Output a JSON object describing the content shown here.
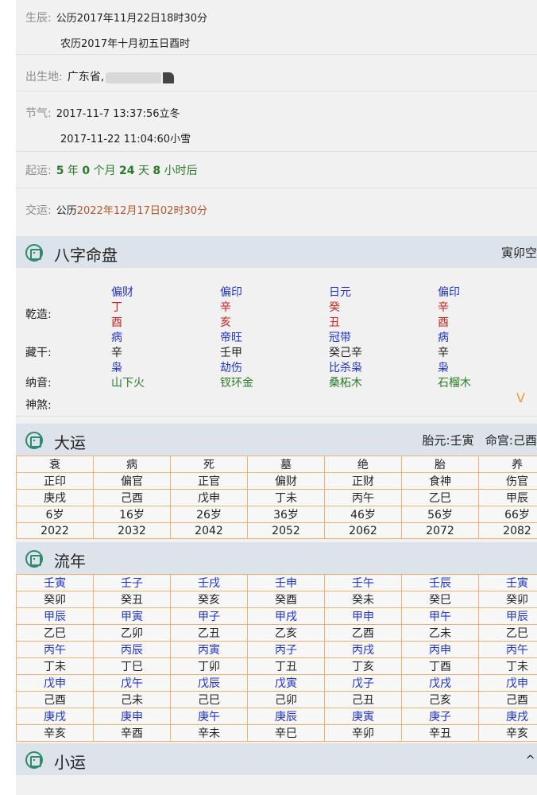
{
  "birth": {
    "label": "生辰:",
    "solar": "公历2017年11月22日18时30分",
    "lunar": "农历2017年十月初五日酉时"
  },
  "birthplace": {
    "label": "出生地:",
    "value": "广东省,"
  },
  "solar_terms": {
    "label": "节气:",
    "term1": "2017-11-7 13:37:56立冬",
    "term2": "2017-11-22 11:04:60小雪"
  },
  "qiyun": {
    "label": "起运:",
    "years": "5",
    "t_year": "年",
    "months": "0",
    "t_month": "个月",
    "days": "24",
    "t_day": "天",
    "hours": "8",
    "t_hour": "小时后"
  },
  "jiaoyun": {
    "label": "交运:",
    "prefix": "公历",
    "value": "2022年12月17日02时30分"
  },
  "bazi": {
    "title": "八字命盘",
    "right": "寅卯空",
    "qianzao_label": "乾造:",
    "canggan_label": "藏干:",
    "nayin_label": "纳音:",
    "shensha_label": "神煞:",
    "chevron": "V",
    "pillars": [
      {
        "shishen": "偏财",
        "gan": "丁",
        "zhi": "酉",
        "state": "病",
        "canggan": "辛",
        "cg_shishen": "枭",
        "nayin": "山下火"
      },
      {
        "shishen": "偏印",
        "gan": "辛",
        "zhi": "亥",
        "state": "帝旺",
        "canggan": "壬甲",
        "cg_shishen": "劫伤",
        "nayin": "钗环金"
      },
      {
        "shishen": "日元",
        "gan": "癸",
        "zhi": "丑",
        "state": "冠带",
        "canggan": "癸己辛",
        "cg_shishen": "比杀枭",
        "nayin": "桑柘木"
      },
      {
        "shishen": "偏印",
        "gan": "辛",
        "zhi": "酉",
        "state": "病",
        "canggan": "辛",
        "cg_shishen": "枭",
        "nayin": "石榴木"
      }
    ]
  },
  "dayun": {
    "title": "大运",
    "taiyuan_label": "胎元:",
    "taiyuan": "壬寅",
    "minggong_label": "命宫:",
    "minggong": "己酉",
    "rows": [
      [
        "衰",
        "病",
        "死",
        "墓",
        "绝",
        "胎",
        "养"
      ],
      [
        "正印",
        "偏官",
        "正官",
        "偏财",
        "正财",
        "食神",
        "伤官"
      ],
      [
        "庚戌",
        "己酉",
        "戊申",
        "丁未",
        "丙午",
        "乙巳",
        "甲辰"
      ],
      [
        "6岁",
        "16岁",
        "26岁",
        "36岁",
        "46岁",
        "56岁",
        "66岁"
      ],
      [
        "2022",
        "2032",
        "2042",
        "2052",
        "2062",
        "2072",
        "2082"
      ]
    ]
  },
  "liunian": {
    "title": "流年",
    "rows": [
      [
        "壬寅",
        "壬子",
        "壬戌",
        "壬申",
        "壬午",
        "壬辰",
        "壬寅"
      ],
      [
        "癸卯",
        "癸丑",
        "癸亥",
        "癸酉",
        "癸未",
        "癸巳",
        "癸卯"
      ],
      [
        "甲辰",
        "甲寅",
        "甲子",
        "甲戌",
        "甲申",
        "甲午",
        "甲辰"
      ],
      [
        "乙巳",
        "乙卯",
        "乙丑",
        "乙亥",
        "乙酉",
        "乙未",
        "乙巳"
      ],
      [
        "丙午",
        "丙辰",
        "丙寅",
        "丙子",
        "丙戌",
        "丙申",
        "丙午"
      ],
      [
        "丁未",
        "丁巳",
        "丁卯",
        "丁丑",
        "丁亥",
        "丁酉",
        "丁未"
      ],
      [
        "戊申",
        "戊午",
        "戊辰",
        "戊寅",
        "戊子",
        "戊戌",
        "戊申"
      ],
      [
        "己酉",
        "己未",
        "己巳",
        "己卯",
        "己丑",
        "己亥",
        "己酉"
      ],
      [
        "庚戌",
        "庚申",
        "庚午",
        "庚辰",
        "庚寅",
        "庚子",
        "庚戌"
      ],
      [
        "辛亥",
        "辛酉",
        "辛未",
        "辛巳",
        "辛卯",
        "辛丑",
        "辛亥"
      ]
    ]
  },
  "xiaoyun": {
    "title": "小运",
    "chevron": "^"
  },
  "colors": {
    "accent_blue": "#2233cc",
    "red": "#d42020",
    "green": "#2a7a2a",
    "brown": "#b2562a",
    "table_border": "#f0b070"
  }
}
